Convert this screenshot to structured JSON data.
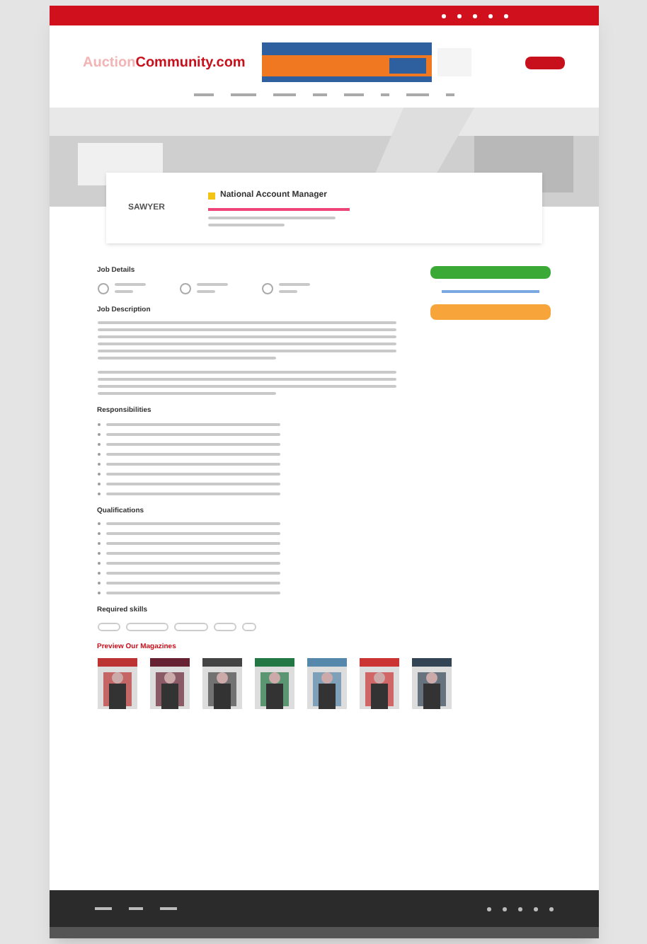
{
  "header": {
    "logo_prefix": "Auction",
    "logo_main": "Community.com"
  },
  "job": {
    "title": "National Account Manager",
    "company_logo": "SAWYER"
  },
  "sections": [
    {
      "heading": "Job Details",
      "kind": "details"
    },
    {
      "heading": "Job Description",
      "kind": "paragraphs"
    },
    {
      "heading": "Responsibilities",
      "kind": "list"
    },
    {
      "heading": "Qualifications",
      "kind": "list"
    },
    {
      "heading": "Required skills",
      "kind": "tags"
    }
  ],
  "magazines": {
    "heading": "Preview Our Magazines"
  }
}
